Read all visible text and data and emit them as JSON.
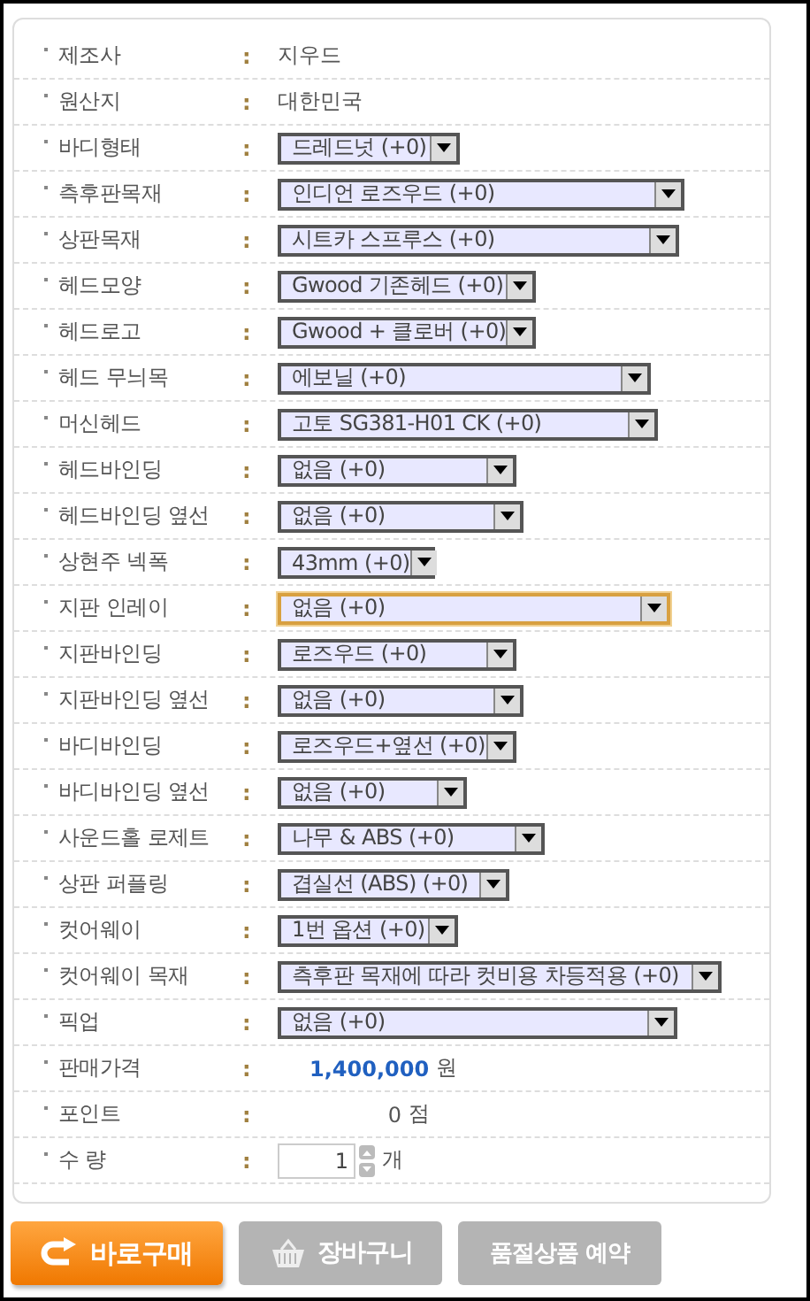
{
  "rows": [
    {
      "kind": "text",
      "label": "제조사",
      "value": "지우드"
    },
    {
      "kind": "text",
      "label": "원산지",
      "value": "대한민국"
    },
    {
      "kind": "select",
      "label": "바디형태",
      "value": "드레드넛 (+0)",
      "focused": false
    },
    {
      "kind": "select",
      "label": "측후판목재",
      "value": "인디언 로즈우드 (+0)",
      "focused": false
    },
    {
      "kind": "select",
      "label": "상판목재",
      "value": "시트카 스프루스 (+0)",
      "focused": false
    },
    {
      "kind": "select",
      "label": "헤드모양",
      "value": "Gwood 기존헤드 (+0)",
      "focused": false
    },
    {
      "kind": "select",
      "label": "헤드로고",
      "value": "Gwood + 클로버 (+0)",
      "focused": false
    },
    {
      "kind": "select",
      "label": "헤드 무늬목",
      "value": "에보닐 (+0)",
      "focused": false
    },
    {
      "kind": "select",
      "label": "머신헤드",
      "value": "고토 SG381-H01 CK (+0)",
      "focused": false
    },
    {
      "kind": "select",
      "label": "헤드바인딩",
      "value": "없음 (+0)",
      "focused": false
    },
    {
      "kind": "select",
      "label": "헤드바인딩 옆선",
      "value": "없음 (+0)",
      "focused": false
    },
    {
      "kind": "select",
      "label": "상현주 넥폭",
      "value": "43mm (+0)",
      "focused": false
    },
    {
      "kind": "select",
      "label": "지판 인레이",
      "value": "없음 (+0)",
      "focused": true
    },
    {
      "kind": "select",
      "label": "지판바인딩",
      "value": "로즈우드 (+0)",
      "focused": false
    },
    {
      "kind": "select",
      "label": "지판바인딩 옆선",
      "value": "없음 (+0)",
      "focused": false
    },
    {
      "kind": "select",
      "label": "바디바인딩",
      "value": "로즈우드+옆선 (+0)",
      "focused": false
    },
    {
      "kind": "select",
      "label": "바디바인딩 옆선",
      "value": "없음 (+0)",
      "focused": false
    },
    {
      "kind": "select",
      "label": "사운드홀 로제트",
      "value": "나무 & ABS (+0)",
      "focused": false
    },
    {
      "kind": "select",
      "label": "상판 퍼플링",
      "value": "겹실선 (ABS) (+0)",
      "focused": false
    },
    {
      "kind": "select",
      "label": "컷어웨이",
      "value": "1번 옵션 (+0)",
      "focused": false
    },
    {
      "kind": "select",
      "label": "컷어웨이 목재",
      "value": "측후판 목재에 따라 컷비용 차등적용 (+0)",
      "focused": false
    },
    {
      "kind": "select",
      "label": "픽업",
      "value": "없음 (+0)",
      "focused": false
    },
    {
      "kind": "price",
      "label": "판매가격",
      "value": "1,400,000",
      "unit": "원"
    },
    {
      "kind": "point",
      "label": "포인트",
      "value": "0",
      "unit": "점"
    },
    {
      "kind": "quantity",
      "label": "수 량",
      "value": "1",
      "unit": "개"
    }
  ],
  "separator": ":",
  "buttons": [
    {
      "kind": "primary",
      "label": "바로구매"
    },
    {
      "kind": "cart",
      "label": "장바구니"
    },
    {
      "kind": "plain",
      "label": "품절상품 예약"
    }
  ]
}
